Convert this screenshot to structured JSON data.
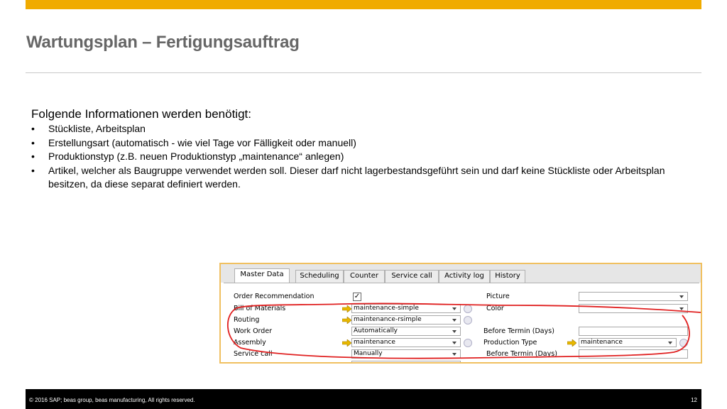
{
  "slide": {
    "title": "Wartungsplan – Fertigungsauftrag",
    "intro": "Folgende Informationen werden benötigt:",
    "bullets": [
      "Stückliste, Arbeitsplan",
      "Erstellungsart (automatisch  - wie viel Tage vor Fälligkeit oder manuell)",
      "Produktionstyp (z.B. neuen Produktionstyp „maintenance“ anlegen)",
      "Artikel, welcher als Baugruppe verwendet werden soll. Dieser darf nicht lagerbestandsgeführt sein und darf keine Stückliste oder Arbeitsplan besitzen, da diese separat definiert werden."
    ]
  },
  "sap_form": {
    "tabs": [
      {
        "label": "Master Data"
      },
      {
        "label": "Scheduling"
      },
      {
        "label": "Counter"
      },
      {
        "label": "Service call"
      },
      {
        "label": "Activity log"
      },
      {
        "label": "History"
      }
    ],
    "active_tab": "Master Data",
    "left_labels": {
      "order_recommendation": "Order Recommendation",
      "bill_of_materials": "Bill of Materials",
      "routing": "Routing",
      "work_order": "Work Order",
      "assembly": "Assembly",
      "service_call": "Service call"
    },
    "right_labels": {
      "picture": "Picture",
      "color": "Color",
      "before_termin_wo": "Before Termin (Days)",
      "production_type": "Production Type",
      "before_termin_sc": "Before Termin (Days)"
    },
    "values": {
      "order_recommendation_checked": "✓",
      "bill_of_materials": "maintenance-simple",
      "routing": "maintenance-rsimple",
      "work_order": "Automatically",
      "assembly": "maintenance",
      "service_call": "Manually",
      "production_type": "maintenance"
    }
  },
  "footer": {
    "copyright": "©  2016 SAP; beas group, beas manufacturing,  All rights reserved.",
    "page_number": "12"
  },
  "colors": {
    "accent_bar": "#f0ab00",
    "title_gray": "#666666",
    "annotation_red": "#e02020",
    "link_arrow": "#e8b800"
  }
}
